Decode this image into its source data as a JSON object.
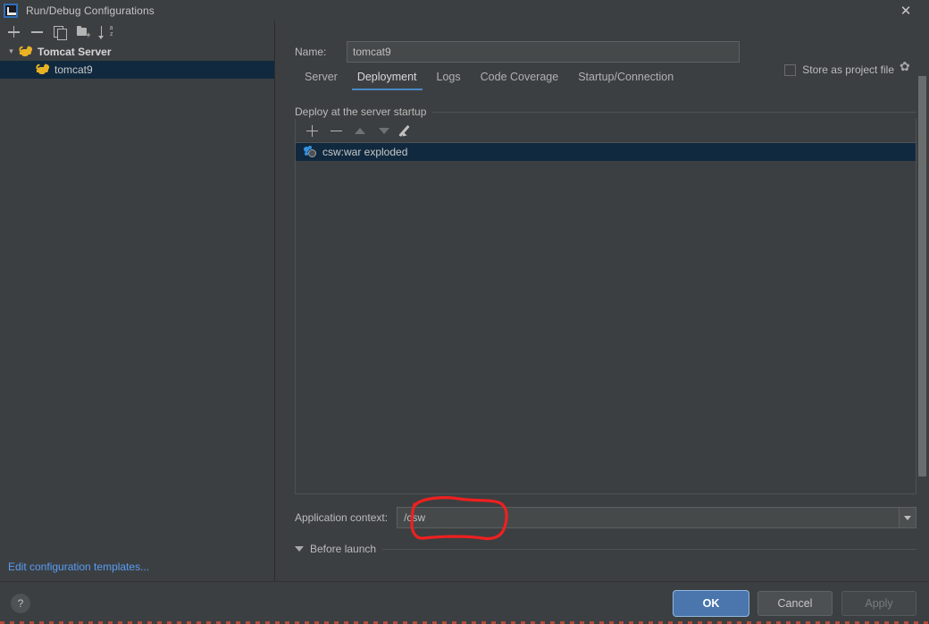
{
  "window": {
    "title": "Run/Debug Configurations",
    "logo_icon": "intellij-idea-logo",
    "close_icon": "close-icon"
  },
  "sidebar": {
    "toolbar": [
      {
        "name": "add-configuration-button",
        "icon": "plus-icon",
        "label": "+"
      },
      {
        "name": "remove-configuration-button",
        "icon": "minus-icon",
        "label": "−"
      },
      {
        "name": "copy-configuration-button",
        "icon": "copy-icon",
        "label": "Copy"
      },
      {
        "name": "save-configuration-button",
        "icon": "folder-add-icon",
        "label": "Save"
      },
      {
        "name": "sort-configurations-button",
        "icon": "sort-alphabetical-icon",
        "label": "Sort"
      }
    ],
    "tree": [
      {
        "label": "Tomcat Server",
        "icon": "tomcat-icon",
        "expanded": true,
        "selected": false
      },
      {
        "label": "tomcat9",
        "icon": "tomcat-icon",
        "expanded": false,
        "selected": true
      }
    ],
    "edit_templates_link": "Edit configuration templates..."
  },
  "form": {
    "name_label": "Name:",
    "name_value": "tomcat9",
    "store_as_project_file_label": "Store as project file",
    "store_as_project_file_checked": false,
    "store_gear_icon": "gear-icon"
  },
  "tabs": [
    {
      "label": "Server",
      "active": false
    },
    {
      "label": "Deployment",
      "active": true
    },
    {
      "label": "Logs",
      "active": false
    },
    {
      "label": "Code Coverage",
      "active": false
    },
    {
      "label": "Startup/Connection",
      "active": false
    }
  ],
  "deployment": {
    "group_title": "Deploy at the server startup",
    "list_toolbar": [
      {
        "name": "add-artifact-button",
        "icon": "plus-icon",
        "enabled": true
      },
      {
        "name": "remove-artifact-button",
        "icon": "minus-icon",
        "enabled": true
      },
      {
        "name": "move-up-button",
        "icon": "triangle-up-icon",
        "enabled": false
      },
      {
        "name": "move-down-button",
        "icon": "triangle-down-icon",
        "enabled": false
      },
      {
        "name": "edit-artifact-button",
        "icon": "pencil-icon",
        "enabled": true
      }
    ],
    "items": [
      {
        "label": "csw:war exploded",
        "icon": "artifact-icon",
        "selected": true
      }
    ],
    "application_context_label": "Application context:",
    "application_context_value": "/csw",
    "dropdown_icon": "chevron-down-icon"
  },
  "before_launch": {
    "label": "Before launch",
    "collapse_icon": "triangle-down-icon"
  },
  "footer": {
    "help_label": "?",
    "ok_label": "OK",
    "cancel_label": "Cancel",
    "apply_label": "Apply",
    "apply_enabled": false
  },
  "annotation": {
    "type": "hand-drawn-ellipse",
    "color": "#ee2020",
    "target": "/csw"
  },
  "colors": {
    "background": "#3c3f41",
    "selection": "#10293e",
    "accent": "#4a88c7",
    "link": "#589df6",
    "primary_button": "#4a76ad",
    "annotation_red": "#ee2020"
  }
}
